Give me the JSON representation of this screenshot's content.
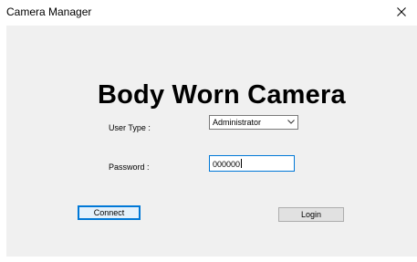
{
  "window": {
    "title": "Camera Manager",
    "close_icon": "close-icon"
  },
  "form": {
    "heading": "Body Worn Camera",
    "user_type_label": "User Type :",
    "user_type_value": "Administrator",
    "password_label": "Password :",
    "password_value": "000000"
  },
  "buttons": {
    "connect_label": "Connect",
    "login_label": "Login"
  },
  "colors": {
    "client_background": "#f0f0f0",
    "focus_border": "#0078d7",
    "button_face": "#e1e1e1"
  }
}
